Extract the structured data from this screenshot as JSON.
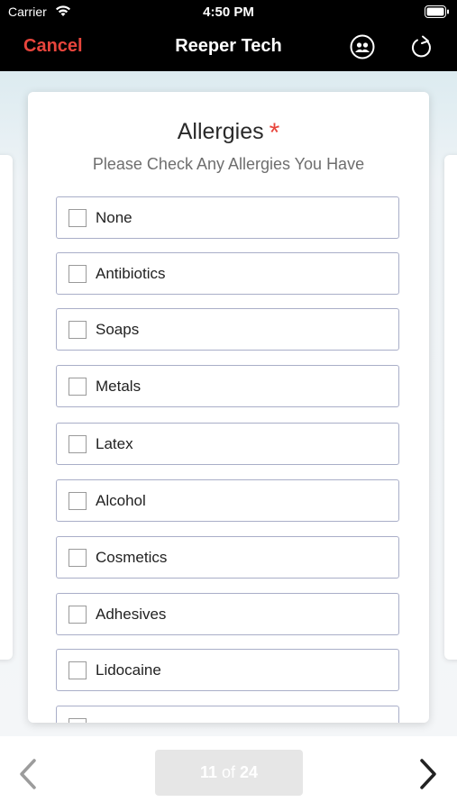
{
  "status_bar": {
    "carrier": "Carrier",
    "time": "4:50 PM"
  },
  "nav": {
    "cancel_label": "Cancel",
    "title": "Reeper Tech"
  },
  "form": {
    "title": "Allergies",
    "required_marker": "*",
    "subtitle": "Please Check Any Allergies You Have",
    "options": [
      {
        "label": "None",
        "checked": false
      },
      {
        "label": "Antibiotics",
        "checked": false
      },
      {
        "label": "Soaps",
        "checked": false
      },
      {
        "label": "Metals",
        "checked": false
      },
      {
        "label": "Latex",
        "checked": false
      },
      {
        "label": "Alcohol",
        "checked": false
      },
      {
        "label": "Cosmetics",
        "checked": false
      },
      {
        "label": "Adhesives",
        "checked": false
      },
      {
        "label": "Lidocaine",
        "checked": false
      },
      {
        "label": "",
        "checked": false
      }
    ]
  },
  "pager": {
    "current": "11",
    "of_label": "of",
    "total": "24"
  },
  "colors": {
    "accent_red": "#e8453c",
    "nav_background": "#000000",
    "border": "#a9aec8"
  },
  "icons": [
    "wifi-icon",
    "battery-icon",
    "people-icon",
    "refresh-icon",
    "chevron-left-icon",
    "chevron-right-icon"
  ]
}
